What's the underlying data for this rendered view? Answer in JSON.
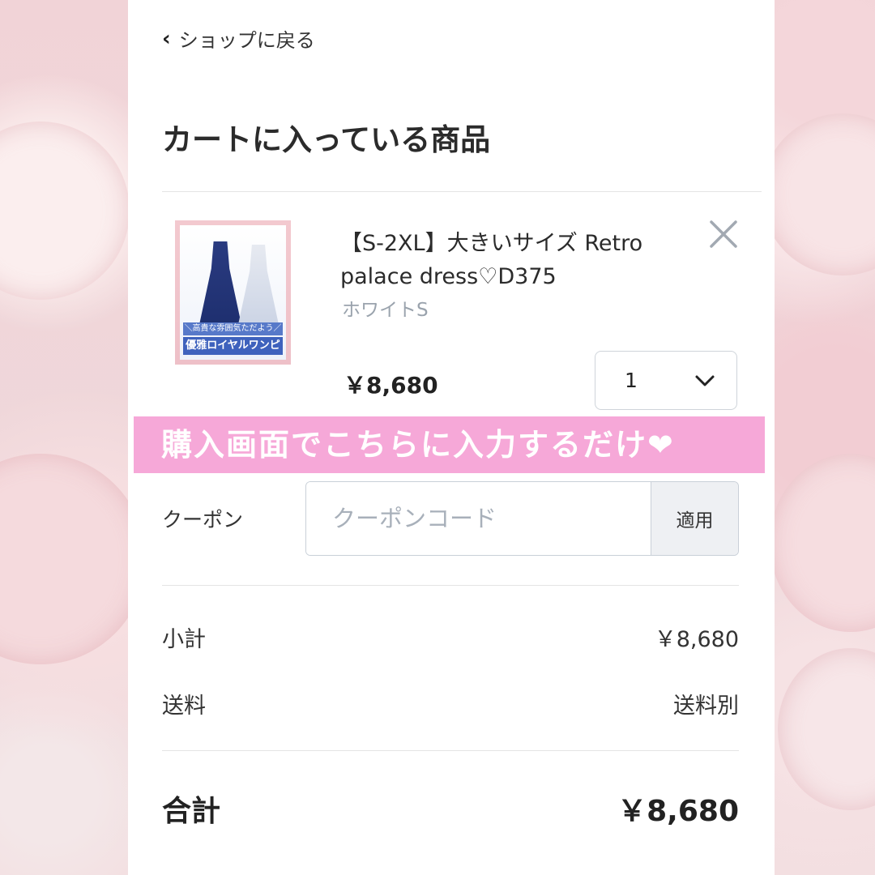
{
  "colors": {
    "banner_bg": "#f6a8d8",
    "panel_bg": "#ffffff",
    "background": "#f2d9dc"
  },
  "nav": {
    "back_label": "ショップに戻る",
    "back_icon": "chevron-left-icon"
  },
  "cart": {
    "title": "カートに入っている商品",
    "item": {
      "name": "【S-2XL】大きいサイズ Retro palace dress♡D375",
      "variant": "ホワイトS",
      "price": "￥8,680",
      "quantity": "1",
      "image_caption_top": "＼高貴な雰囲気ただよう／",
      "image_caption_bottom": "優雅ロイヤルワンピ",
      "remove_icon": "close-icon",
      "quantity_icon": "chevron-down-icon"
    }
  },
  "banner": {
    "text": "購入画面でこちらに入力するだけ❤"
  },
  "coupon": {
    "label": "クーポン",
    "placeholder": "クーポンコード",
    "value": "",
    "apply_label": "適用"
  },
  "summary": {
    "subtotal_label": "小計",
    "subtotal_value": "￥8,680",
    "shipping_label": "送料",
    "shipping_value": "送料別",
    "total_label": "合計",
    "total_value": "￥8,680"
  }
}
